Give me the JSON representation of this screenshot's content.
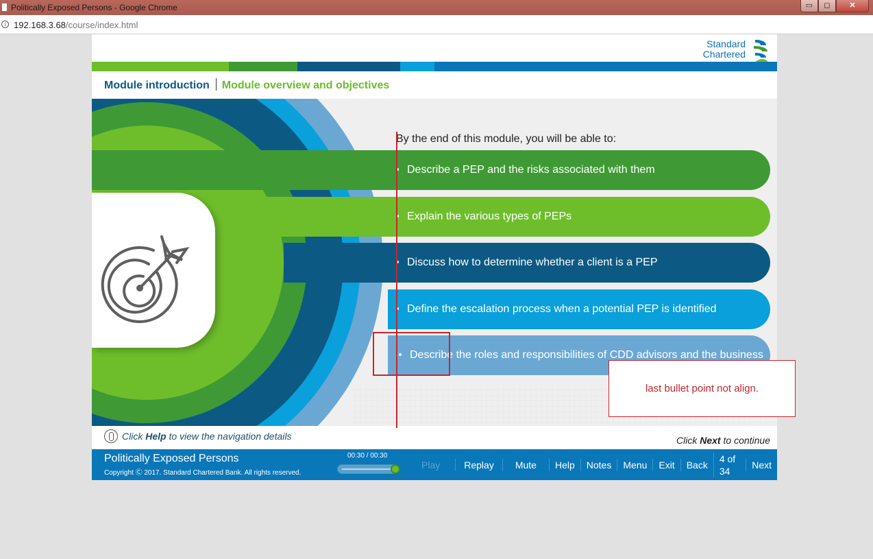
{
  "browser": {
    "window_title": "Politically Exposed Persons - Google Chrome",
    "url_host": "192.168.3.68",
    "url_path": "/course/index.html",
    "buttons": {
      "minimize": "▭",
      "maximize": "◻",
      "close": "✕"
    }
  },
  "course": {
    "logo": {
      "line1": "Standard",
      "line2": "Chartered"
    },
    "breadcrumb": {
      "section": "Module introduction",
      "page": "Module overview and objectives"
    },
    "intro": "By the end of this module, you will be able to:",
    "objectives": [
      {
        "text": "Describe a PEP and the risks associated with them",
        "color": "#3f9a35"
      },
      {
        "text": "Explain the various types of PEPs",
        "color": "#6ebe2b"
      },
      {
        "text": "Discuss how to determine whether a client is a PEP",
        "color": "#0c5a83"
      },
      {
        "text": "Define the escalation process when a potential PEP is identified",
        "color": "#0aa0dc"
      },
      {
        "text": "Describe the roles and responsibilities of CDD advisors and the business",
        "color": "#6aa8d3"
      }
    ],
    "help_hint": {
      "pre": "Click ",
      "bold": "Help",
      "post": " to view the navigation details"
    },
    "next_hint": {
      "pre": "Click ",
      "bold": "Next",
      "post": " to continue"
    },
    "footer": {
      "title": "Politically Exposed Persons",
      "copyright": "Copyright Ⓒ 2017. Standard Chartered Bank. All rights reserved.",
      "time": "00:30 / 00:30",
      "progress": 1.0,
      "nav": {
        "play": "Play",
        "replay": "Replay",
        "mute": "Mute",
        "help": "Help",
        "notes": "Notes",
        "menu": "Menu",
        "exit": "Exit",
        "back": "Back",
        "page": "4 of 34",
        "next": "Next"
      }
    }
  },
  "annotation": {
    "note": "last bullet point not align."
  },
  "colors": {
    "green_dark": "#3f9a35",
    "green_light": "#6ebe2b",
    "navy": "#0c5a83",
    "cyan": "#0aa0dc",
    "sky": "#6aa8d3",
    "footer_blue": "#0a77b9",
    "annotation_red": "#c4262e"
  }
}
